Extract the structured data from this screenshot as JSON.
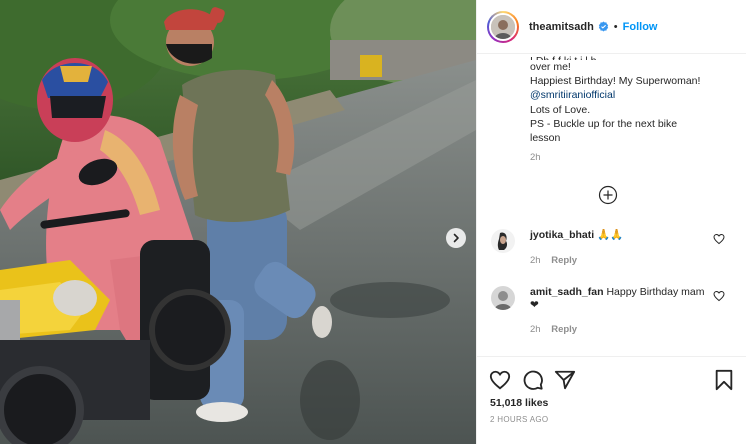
{
  "post": {
    "username": "theamitsadh",
    "follow_label": "Follow",
    "separator": "•",
    "caption": {
      "cut_line": "I Dh f f ki t i l b",
      "line1": "over me!",
      "line2": "Happiest Birthday! My Superwoman!",
      "mention": "@smritiiraniofficial",
      "line3": "Lots of Love.",
      "line4": "PS - Buckle up for the next bike",
      "line5": "lesson",
      "timestamp": "2h"
    },
    "comments": [
      {
        "user": "jyotika_bhati",
        "text": "🙏🙏",
        "time": "2h",
        "reply_label": "Reply"
      },
      {
        "user": "amit_sadh_fan",
        "text": "Happy Birthday mam❤",
        "time": "2h",
        "reply_label": "Reply"
      }
    ],
    "likes": "51,018 likes",
    "time_ago": "2 HOURS AGO"
  },
  "icons": {
    "verified": "verified-badge-icon",
    "load_more": "plus-circle-icon",
    "like": "heart-icon",
    "comment": "comment-bubble-icon",
    "share": "paper-plane-icon",
    "save": "bookmark-icon",
    "next": "chevron-right-icon"
  },
  "colors": {
    "accent": "#0095f6",
    "mention": "#00376b",
    "muted": "#8e8e8e",
    "text": "#262626"
  }
}
